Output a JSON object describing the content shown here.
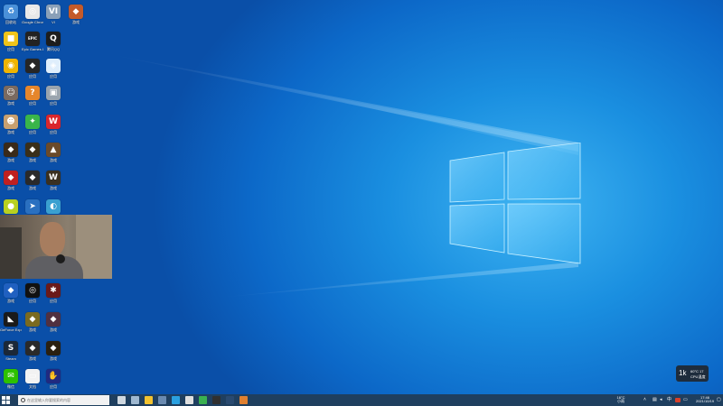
{
  "desktop": {
    "icons": [
      {
        "id": "recycle-bin",
        "label": "回收站",
        "color": "#4a90d9",
        "glyph": "♻"
      },
      {
        "id": "chrome",
        "label": "Google Chrome",
        "color": "#e8e8e8",
        "glyph": "◎"
      },
      {
        "id": "vi-app",
        "label": "VI",
        "color": "#8aa0b8",
        "glyph": "VI"
      },
      {
        "id": "game-app",
        "label": "游戏",
        "color": "#c45a2a",
        "glyph": "◆"
      },
      {
        "id": "app-yellow",
        "label": "应用",
        "color": "#f0c419",
        "glyph": "■"
      },
      {
        "id": "epic-games",
        "label": "Epic Games Launcher",
        "color": "#222222",
        "glyph": "EPIC"
      },
      {
        "id": "qq",
        "label": "腾讯QQ",
        "color": "#1d1d1d",
        "glyph": "Q"
      },
      {
        "id": "app-circle",
        "label": "应用",
        "color": "#f0b400",
        "glyph": "◉"
      },
      {
        "id": "app-dark",
        "label": "应用",
        "color": "#262626",
        "glyph": "◆"
      },
      {
        "id": "app-blue",
        "label": "应用",
        "color": "#dfeefc",
        "glyph": "◈"
      },
      {
        "id": "game-char",
        "label": "游戏",
        "color": "#7a6a60",
        "glyph": "☺"
      },
      {
        "id": "app-orange",
        "label": "应用",
        "color": "#e6862b",
        "glyph": "?"
      },
      {
        "id": "app-gray",
        "label": "应用",
        "color": "#9aa4ae",
        "glyph": "▣"
      },
      {
        "id": "game-char2",
        "label": "游戏",
        "color": "#c8a070",
        "glyph": "☻"
      },
      {
        "id": "app-green",
        "label": "应用",
        "color": "#39b54a",
        "glyph": "✦"
      },
      {
        "id": "app-red",
        "label": "应用",
        "color": "#d9262c",
        "glyph": "W"
      },
      {
        "id": "game-a",
        "label": "游戏",
        "color": "#3a2a1a",
        "glyph": "◆"
      },
      {
        "id": "game-b",
        "label": "游戏",
        "color": "#3a2f1a",
        "glyph": "◆"
      },
      {
        "id": "game-c",
        "label": "游戏",
        "color": "#6a4a2a",
        "glyph": "▲"
      },
      {
        "id": "game-d",
        "label": "游戏",
        "color": "#c02020",
        "glyph": "◆"
      },
      {
        "id": "game-e",
        "label": "游戏",
        "color": "#2a2a2a",
        "glyph": "◆"
      },
      {
        "id": "game-f",
        "label": "游戏",
        "color": "#3a3020",
        "glyph": "W"
      },
      {
        "id": "app-lime",
        "label": "应用",
        "color": "#b8d020",
        "glyph": "●"
      },
      {
        "id": "app-bluearrow",
        "label": "应用",
        "color": "#2a70c0",
        "glyph": "➤"
      },
      {
        "id": "app-teal",
        "label": "应用",
        "color": "#3aa0d0",
        "glyph": "◐"
      },
      {
        "id": "app-sonic",
        "label": "游戏",
        "color": "#2060c0",
        "glyph": "◆"
      },
      {
        "id": "app-black",
        "label": "应用",
        "color": "#111111",
        "glyph": "◎"
      },
      {
        "id": "app-maroon",
        "label": "应用",
        "color": "#6a1a1a",
        "glyph": "✱"
      },
      {
        "id": "nvidia",
        "label": "GeForce Experience",
        "color": "#1a1a1a",
        "glyph": "◣"
      },
      {
        "id": "game-g",
        "label": "游戏",
        "color": "#7a6a20",
        "glyph": "◆"
      },
      {
        "id": "game-h",
        "label": "游戏",
        "color": "#503040",
        "glyph": "◆"
      },
      {
        "id": "steam",
        "label": "Steam",
        "color": "#1b2838",
        "glyph": "S"
      },
      {
        "id": "game-i",
        "label": "游戏",
        "color": "#2a2a2a",
        "glyph": "◆"
      },
      {
        "id": "game-j",
        "label": "游戏",
        "color": "#2a2010",
        "glyph": "◆"
      },
      {
        "id": "wechat",
        "label": "微信",
        "color": "#2dc100",
        "glyph": "✉"
      },
      {
        "id": "doc-file",
        "label": "文档",
        "color": "#f2f2f2",
        "glyph": "▭"
      },
      {
        "id": "app-purple",
        "label": "应用",
        "color": "#202a80",
        "glyph": "✋"
      }
    ]
  },
  "taskbar": {
    "search_placeholder": "在这里输入你要搜索的内容",
    "apps": [
      {
        "id": "task-view",
        "color": "#cfd8e0"
      },
      {
        "id": "widgets",
        "color": "#9fb8d0"
      },
      {
        "id": "file-explorer",
        "color": "#f2c230"
      },
      {
        "id": "store",
        "color": "#6a8ab0"
      },
      {
        "id": "edge",
        "color": "#2aa0e0"
      },
      {
        "id": "chrome-tb",
        "color": "#e0e0e0"
      },
      {
        "id": "app-green-tb",
        "color": "#3ab050"
      },
      {
        "id": "obs",
        "color": "#303030"
      },
      {
        "id": "steam-tb",
        "color": "#2a4a70"
      },
      {
        "id": "game-tb",
        "color": "#e08030"
      }
    ],
    "tray": {
      "weather_temp": "16°C",
      "weather_text": "小雨",
      "time": "17:46",
      "date": "2021/10/19"
    }
  },
  "widget": {
    "value": "1k",
    "line1": "60°C 17",
    "line2": "CPU温度"
  },
  "colors": {
    "taskbar": "#1f3f5f",
    "desktop_center": "#3fb4f2",
    "desktop_edge": "#0a4fa8"
  }
}
